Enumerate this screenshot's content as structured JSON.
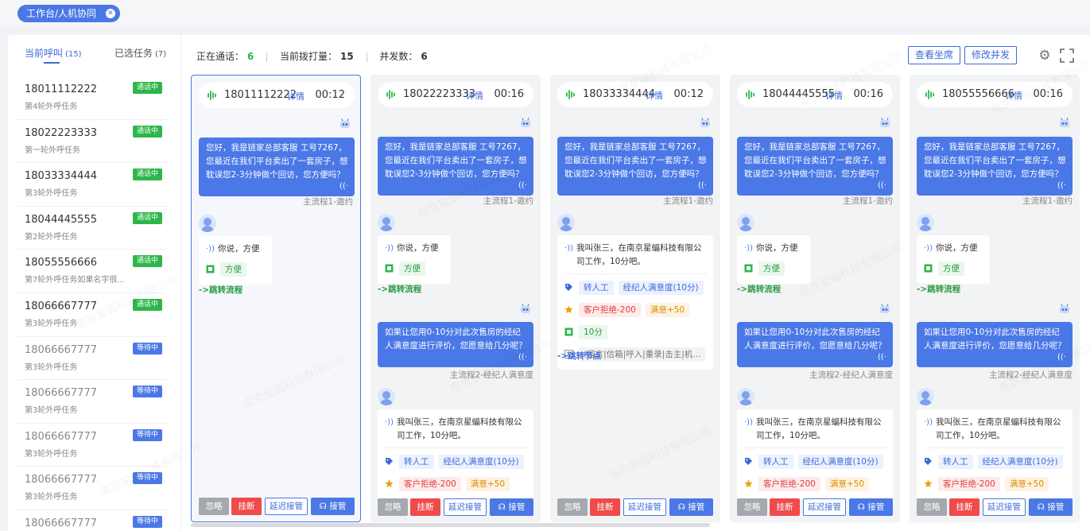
{
  "breadcrumb": {
    "label": "工作台/人机协同",
    "close_icon": "close-circle-icon"
  },
  "tabs": [
    {
      "label": "当前呼叫",
      "count": "(15)"
    },
    {
      "label": "已选任务",
      "count": "(7)"
    }
  ],
  "calls": [
    {
      "phone": "18011112222",
      "task": "第4轮外呼任务",
      "status": "通话中"
    },
    {
      "phone": "18022223333",
      "task": "第一轮外呼任务",
      "status": "通话中"
    },
    {
      "phone": "18033334444",
      "task": "第3轮外呼任务",
      "status": "通话中"
    },
    {
      "phone": "18044445555",
      "task": "第2轮外呼任务",
      "status": "通话中"
    },
    {
      "phone": "18055556666",
      "task": "第7轮外呼任务如果名字很...",
      "status": "通话中"
    },
    {
      "phone": "18066667777",
      "task": "第3轮外呼任务",
      "status": "通话中"
    },
    {
      "phone": "18066667777",
      "task": "第3轮外呼任务",
      "status": "等待中"
    },
    {
      "phone": "18066667777",
      "task": "第3轮外呼任务",
      "status": "等待中"
    },
    {
      "phone": "18066667777",
      "task": "第3轮外呼任务",
      "status": "等待中"
    },
    {
      "phone": "18066667777",
      "task": "第3轮外呼任务",
      "status": "等待中"
    },
    {
      "phone": "18066667777",
      "task": "",
      "status": "等待中"
    }
  ],
  "stats": {
    "talking_label": "正在通话：",
    "talking": "6",
    "dialing_label": "当前拨打量：",
    "dialing": "15",
    "concurrency_label": "并发数：",
    "concurrency": "6"
  },
  "header_buttons": {
    "view_seats": "查看坐席",
    "modify_concurrency": "修改并发"
  },
  "greeting": "您好，我是链家总部客服 工号7267，您最近在我们平台卖出了一套房子，想耽误您2-3分钟做个回访，您方便吗？",
  "flow1": "主流程1-邀约",
  "reply1": "你说，方便",
  "intent1": "方便",
  "jump_flow": "->跳转流程",
  "jump_node": "->跳转节点",
  "question2": "如果让您用0-10分对此次售房的经纪人满意度进行评价，您愿意给几分呢？",
  "flow2": "主流程2-经纪人满意度",
  "reply2": "我叫张三，在南京星蝠科技有限公司工作，10分吧。",
  "tags": {
    "transfer": "转人工",
    "satisfaction": "经纪人满意度(10分)",
    "refuse": "客户拒绝-200",
    "satisfied": "满意+50",
    "ten": "10分",
    "keywords": "(留言|信箱|呼入|重录|击主|机..."
  },
  "actions": {
    "ignore": "忽略",
    "hangup": "挂断",
    "delay": "延迟接管",
    "takeover": "接管"
  },
  "cards": [
    {
      "phone": "18011112222",
      "detail": "详情",
      "time": "00:12"
    },
    {
      "phone": "18022223333",
      "detail": "详情",
      "time": "00:16"
    },
    {
      "phone": "18033334444",
      "detail": "详情",
      "time": "00:12"
    },
    {
      "phone": "18044445555",
      "detail": "详情",
      "time": "00:16"
    },
    {
      "phone": "18055556666",
      "detail": "详情",
      "time": "00:16"
    }
  ],
  "watermark": "南京星蝠科技有限公司",
  "colors": {
    "primary": "#4a78e6",
    "talking": "#2db64a",
    "hangup": "#ef4b4b"
  }
}
